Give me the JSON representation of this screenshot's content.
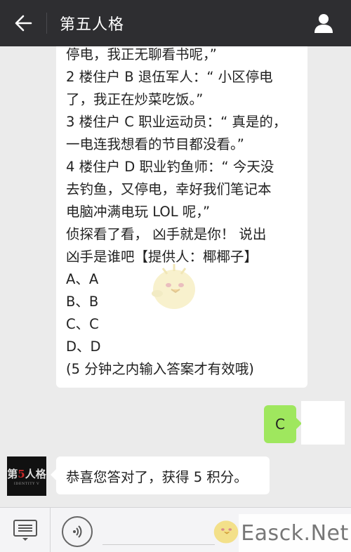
{
  "header": {
    "title": "第五人格",
    "back_icon": "arrow-left-icon",
    "profile_icon": "person-icon"
  },
  "messages": {
    "question_lines": [
      "停电，我正无聊看书呢，”",
      "2 楼住户 B 退伍军人：“ 小区停电",
      "了，我正在炒菜吃饭。”",
      "3 楼住户 C 职业运动员：“ 真是的，",
      "一电连我想看的节目都没看。”",
      "4 楼住户 D 职业钓鱼师：“ 今天没",
      "去钓鱼，又停电，幸好我们笔记本",
      "电脑冲满电玩 LOL 呢，”",
      "侦探看了看， 凶手就是你！ 说出",
      "凶手是谁吧【提供人：椰椰子】",
      "A、A",
      "B、B",
      "C、C",
      "D、D",
      "(5 分钟之内输入答案才有效哦)"
    ],
    "user_reply": "C",
    "bot_reply": "恭喜您答对了，获得 5 积分。",
    "bot_avatar": {
      "main_prefix": "第",
      "main_five": "5",
      "main_suffix": "人格",
      "sub": "IDENTITY V"
    }
  },
  "footer": {
    "menu_icon": "menu-list-icon",
    "voice_icon": "voice-icon"
  },
  "watermark": {
    "site": "Easck.Net"
  }
}
